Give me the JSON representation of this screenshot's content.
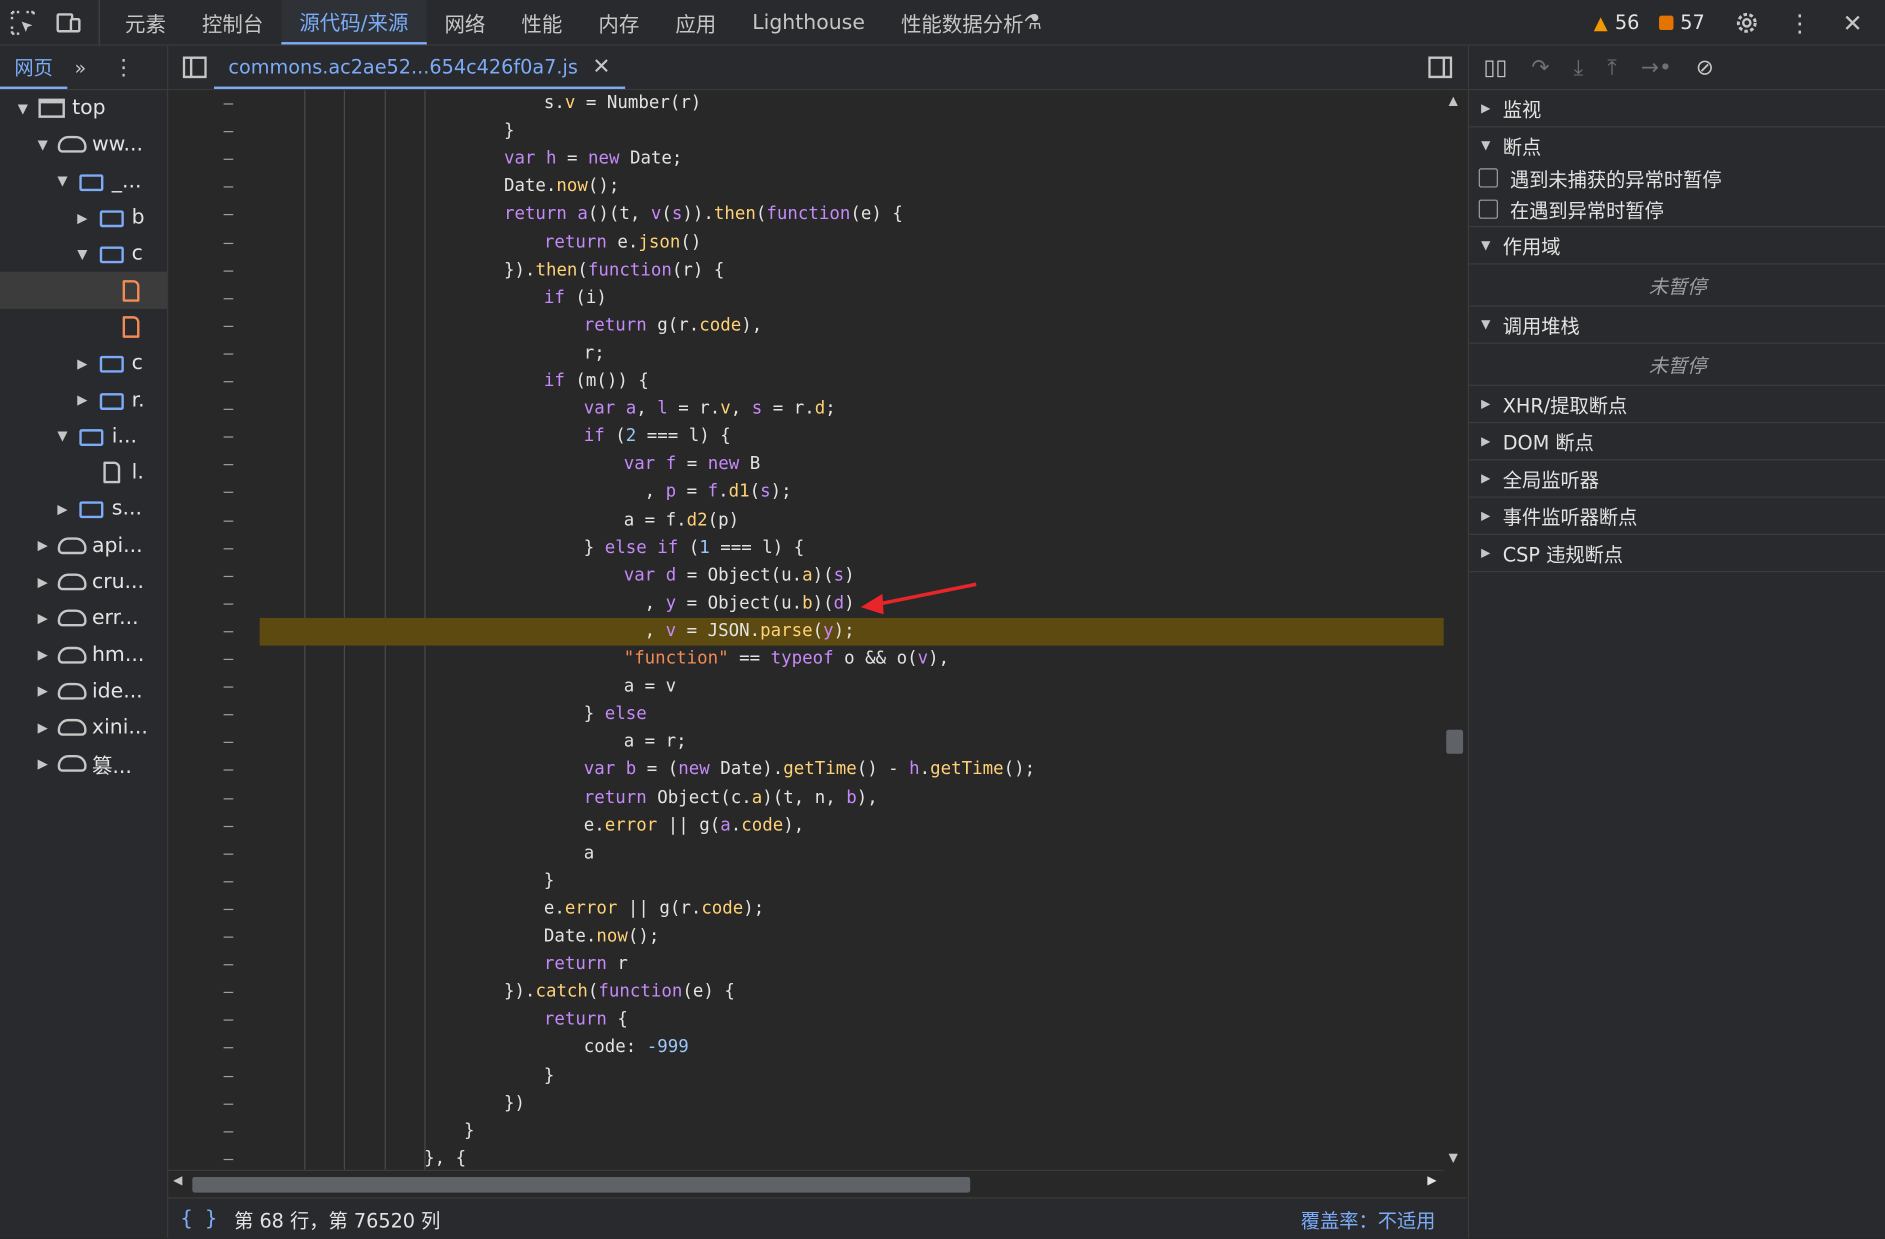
{
  "toolbar": {
    "tabs": [
      "元素",
      "控制台",
      "源代码/来源",
      "网络",
      "性能",
      "内存",
      "应用",
      "Lighthouse",
      "性能数据分析"
    ],
    "active_tab": "源代码/来源",
    "warnings": "56",
    "issues": "57"
  },
  "navigator": {
    "tab_label": "网页",
    "tree": [
      {
        "label": "top",
        "depth": 0,
        "icon": "frame-icon",
        "expanded": true
      },
      {
        "label": "ww...",
        "depth": 1,
        "icon": "cloud-icon",
        "expanded": true
      },
      {
        "label": "_...",
        "depth": 2,
        "icon": "folder-icon",
        "expanded": true
      },
      {
        "label": "b",
        "depth": 3,
        "icon": "folder-icon",
        "expanded": false
      },
      {
        "label": "c",
        "depth": 3,
        "icon": "folder-icon",
        "expanded": true
      },
      {
        "label": "",
        "depth": 4,
        "icon": "js-file-icon",
        "selected": true
      },
      {
        "label": "",
        "depth": 4,
        "icon": "js-file-icon"
      },
      {
        "label": "c",
        "depth": 3,
        "icon": "folder-icon",
        "expanded": false
      },
      {
        "label": "r.",
        "depth": 3,
        "icon": "folder-icon",
        "expanded": false
      },
      {
        "label": "i...",
        "depth": 2,
        "icon": "folder-icon",
        "expanded": true
      },
      {
        "label": "l.",
        "depth": 3,
        "icon": "file-icon"
      },
      {
        "label": "s...",
        "depth": 2,
        "icon": "folder-icon",
        "expanded": false
      },
      {
        "label": "api...",
        "depth": 1,
        "icon": "cloud-icon",
        "expanded": false
      },
      {
        "label": "cru...",
        "depth": 1,
        "icon": "cloud-icon",
        "expanded": false
      },
      {
        "label": "err...",
        "depth": 1,
        "icon": "cloud-icon",
        "expanded": false
      },
      {
        "label": "hm...",
        "depth": 1,
        "icon": "cloud-icon",
        "expanded": false
      },
      {
        "label": "ide...",
        "depth": 1,
        "icon": "cloud-icon",
        "expanded": false
      },
      {
        "label": "xini...",
        "depth": 1,
        "icon": "cloud-icon",
        "expanded": false
      },
      {
        "label": "篡...",
        "depth": 1,
        "icon": "cloud-icon",
        "expanded": false
      }
    ]
  },
  "editor": {
    "file_tab": "commons.ac2ae52...654c426f0a7.js",
    "highlight_line": 19,
    "lines": [
      {
        "i": 7,
        "t": "s.v = Number(r)"
      },
      {
        "i": 6,
        "t": "}"
      },
      {
        "i": 6,
        "t": "var h = new Date;"
      },
      {
        "i": 6,
        "t": "Date.now();"
      },
      {
        "i": 6,
        "t": "return a()(t, v(s)).then(function(e) {"
      },
      {
        "i": 7,
        "t": "return e.json()"
      },
      {
        "i": 6,
        "t": "}).then(function(r) {"
      },
      {
        "i": 7,
        "t": "if (i)"
      },
      {
        "i": 8,
        "t": "return g(r.code),"
      },
      {
        "i": 8,
        "t": "r;"
      },
      {
        "i": 7,
        "t": "if (m()) {"
      },
      {
        "i": 8,
        "t": "var a, l = r.v, s = r.d;"
      },
      {
        "i": 8,
        "t": "if (2 === l) {"
      },
      {
        "i": 9,
        "t": "var f = new B"
      },
      {
        "i": 9,
        "t": "  , p = f.d1(s);"
      },
      {
        "i": 9,
        "t": "a = f.d2(p)"
      },
      {
        "i": 8,
        "t": "} else if (1 === l) {"
      },
      {
        "i": 9,
        "t": "var d = Object(u.a)(s)"
      },
      {
        "i": 9,
        "t": "  , y = Object(u.b)(d)"
      },
      {
        "i": 9,
        "t": "  , v = JSON.parse(y);"
      },
      {
        "i": 9,
        "t": "\"function\" == typeof o && o(v),"
      },
      {
        "i": 9,
        "t": "a = v"
      },
      {
        "i": 8,
        "t": "} else"
      },
      {
        "i": 9,
        "t": "a = r;"
      },
      {
        "i": 8,
        "t": "var b = (new Date).getTime() - h.getTime();"
      },
      {
        "i": 8,
        "t": "return Object(c.a)(t, n, b),"
      },
      {
        "i": 8,
        "t": "e.error || g(a.code),"
      },
      {
        "i": 8,
        "t": "a"
      },
      {
        "i": 7,
        "t": "}"
      },
      {
        "i": 7,
        "t": "e.error || g(r.code);"
      },
      {
        "i": 7,
        "t": "Date.now();"
      },
      {
        "i": 7,
        "t": "return r"
      },
      {
        "i": 6,
        "t": "}).catch(function(e) {"
      },
      {
        "i": 7,
        "t": "return {"
      },
      {
        "i": 8,
        "t": "code: -999"
      },
      {
        "i": 7,
        "t": "}"
      },
      {
        "i": 6,
        "t": "})"
      },
      {
        "i": 5,
        "t": "}"
      },
      {
        "i": 4,
        "t": "}, {"
      }
    ]
  },
  "status": {
    "position": "第 68 行，第 76520 列",
    "coverage": "覆盖率：不适用"
  },
  "debugger": {
    "sections": {
      "watch": "监视",
      "breakpoints": "断点",
      "scope": "作用域",
      "callstack": "调用堆栈",
      "xhr": "XHR/提取断点",
      "dom": "DOM 断点",
      "global": "全局监听器",
      "event": "事件监听器断点",
      "csp": "CSP 违规断点"
    },
    "checkbox_uncaught": "遇到未捕获的异常时暂停",
    "checkbox_caught": "在遇到异常时暂停",
    "not_paused": "未暂停"
  },
  "colors": {
    "accent": "#7cacf8",
    "highlight_line": "#5c4a10",
    "annotation_arrow": "#e8262a"
  }
}
